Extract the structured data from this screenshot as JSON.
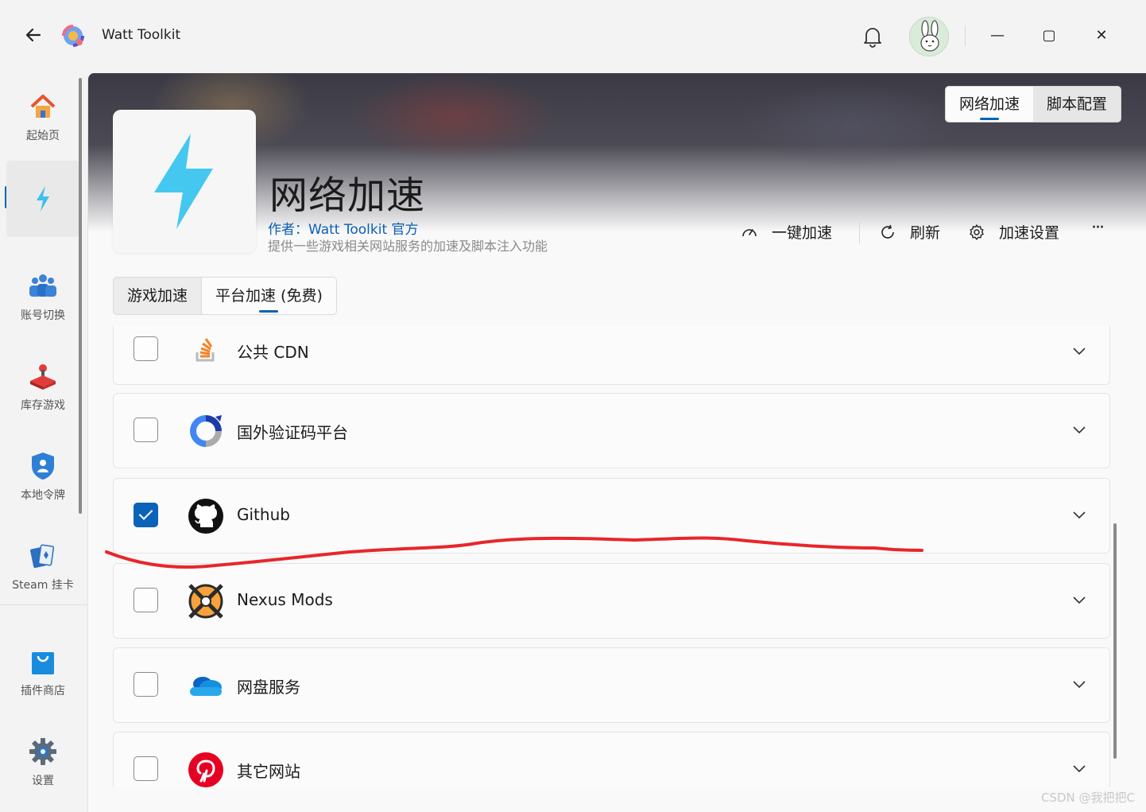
{
  "app": {
    "title": "Watt Toolkit"
  },
  "window": {
    "minimize": "—",
    "maximize": "▢",
    "close": "✕"
  },
  "sidebar": {
    "items": [
      {
        "label": "起始页",
        "icon": "home-icon"
      },
      {
        "label": "",
        "icon": "lightning-icon",
        "active": true
      },
      {
        "label": "账号切换",
        "icon": "accounts-icon"
      },
      {
        "label": "库存游戏",
        "icon": "joystick-icon"
      },
      {
        "label": "本地令牌",
        "icon": "shield-user-icon"
      },
      {
        "label": "Steam 挂卡",
        "icon": "cards-icon"
      },
      {
        "label": "插件商店",
        "icon": "store-bag-icon"
      },
      {
        "label": "设置",
        "icon": "gear-icon"
      }
    ]
  },
  "header_segments": {
    "network": "网络加速",
    "script": "脚本配置"
  },
  "plugin": {
    "title": "网络加速",
    "author": "作者：Watt Toolkit  官方",
    "description": "提供一些游戏相关网站服务的加速及脚本注入功能"
  },
  "actions": {
    "one_click": "一键加速",
    "refresh": "刷新",
    "settings": "加速设置",
    "more": "···"
  },
  "tabs": {
    "game": "游戏加速",
    "platform": "平台加速 (免费)"
  },
  "list": [
    {
      "label": "公共 CDN",
      "checked": false,
      "icon": "stackoverflow-icon"
    },
    {
      "label": "国外验证码平台",
      "checked": false,
      "icon": "recaptcha-icon"
    },
    {
      "label": "Github",
      "checked": true,
      "icon": "github-icon"
    },
    {
      "label": "Nexus Mods",
      "checked": false,
      "icon": "nexusmods-icon"
    },
    {
      "label": "网盘服务",
      "checked": false,
      "icon": "onedrive-icon"
    },
    {
      "label": "其它网站",
      "checked": false,
      "icon": "pinterest-icon"
    }
  ],
  "watermark": "CSDN @我把把C",
  "colors": {
    "accent": "#0a63b8",
    "annotation": "#e8262b"
  }
}
